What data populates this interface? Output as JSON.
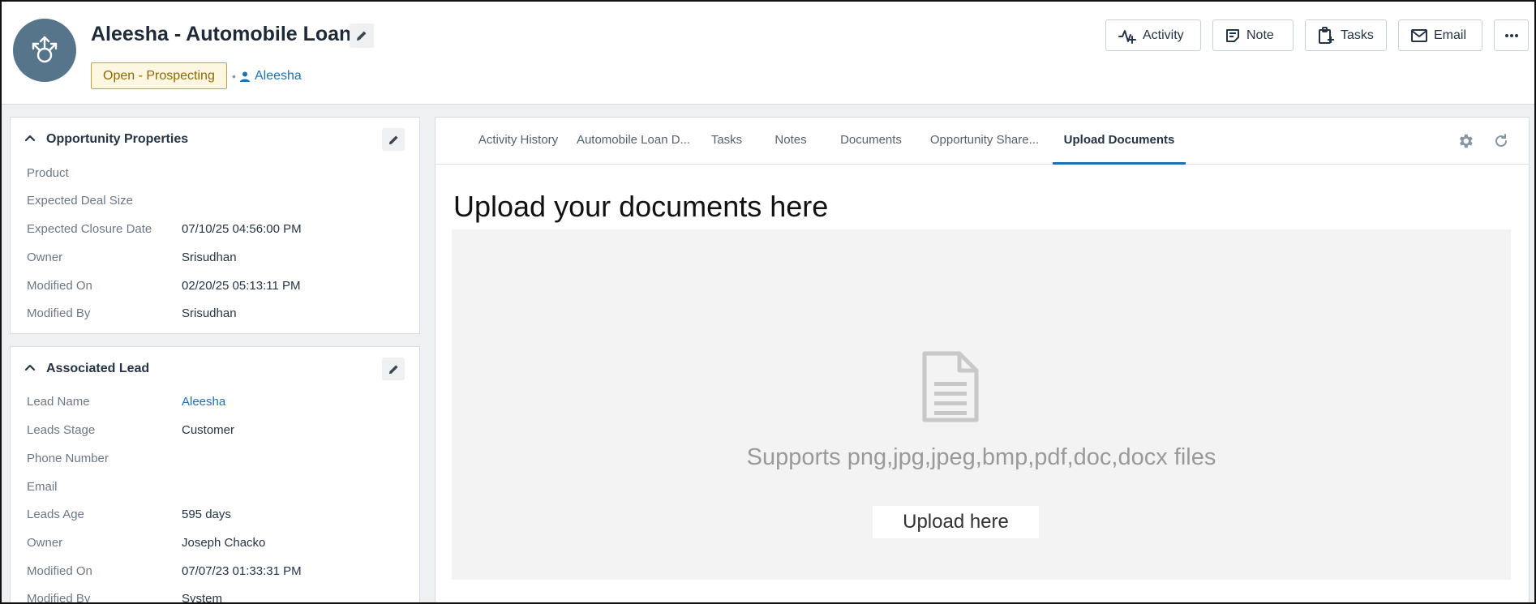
{
  "header": {
    "title": "Aleesha - Automobile Loan",
    "status": "Open - Prospecting",
    "separator": "•",
    "owner_link": "Aleesha",
    "actions": {
      "activity": "Activity",
      "note": "Note",
      "tasks": "Tasks",
      "email": "Email"
    },
    "icons": [
      "opportunity-avatar-icon",
      "pencil-icon",
      "activity-icon",
      "note-icon",
      "tasks-icon",
      "email-icon",
      "more-icon",
      "person-icon"
    ]
  },
  "opportunity_properties": {
    "title": "Opportunity Properties",
    "rows": [
      {
        "label": "Product",
        "value": ""
      },
      {
        "label": "Expected Deal Size",
        "value": ""
      },
      {
        "label": "Expected Closure Date",
        "value": "07/10/25 04:56:00 PM"
      },
      {
        "label": "Owner",
        "value": "Srisudhan"
      },
      {
        "label": "Modified On",
        "value": "02/20/25 05:13:11 PM"
      },
      {
        "label": "Modified By",
        "value": "Srisudhan"
      }
    ]
  },
  "associated_lead": {
    "title": "Associated Lead",
    "rows": [
      {
        "label": "Lead Name",
        "value": "Aleesha"
      },
      {
        "label": "Leads Stage",
        "value": "Customer"
      },
      {
        "label": "Phone Number",
        "value": ""
      },
      {
        "label": "Email",
        "value": ""
      },
      {
        "label": "Leads Age",
        "value": "595 days"
      },
      {
        "label": "Owner",
        "value": "Joseph Chacko"
      },
      {
        "label": "Modified On",
        "value": "07/07/23 01:33:31 PM"
      },
      {
        "label": "Modified By",
        "value": "System"
      }
    ]
  },
  "tabs": [
    {
      "label": "Activity History"
    },
    {
      "label": "Automobile Loan D..."
    },
    {
      "label": "Tasks"
    },
    {
      "label": "Notes"
    },
    {
      "label": "Documents"
    },
    {
      "label": "Opportunity Share..."
    },
    {
      "label": "Upload Documents",
      "active": true
    }
  ],
  "upload": {
    "heading": "Upload your documents here",
    "supports": "Supports png,jpg,jpeg,bmp,pdf,doc,docx files",
    "button": "Upload here"
  },
  "colors": {
    "accent": "#1f6fb3",
    "avatar_bg": "#56748a",
    "status_border": "#c8a13a",
    "status_text": "#8f6a00"
  }
}
